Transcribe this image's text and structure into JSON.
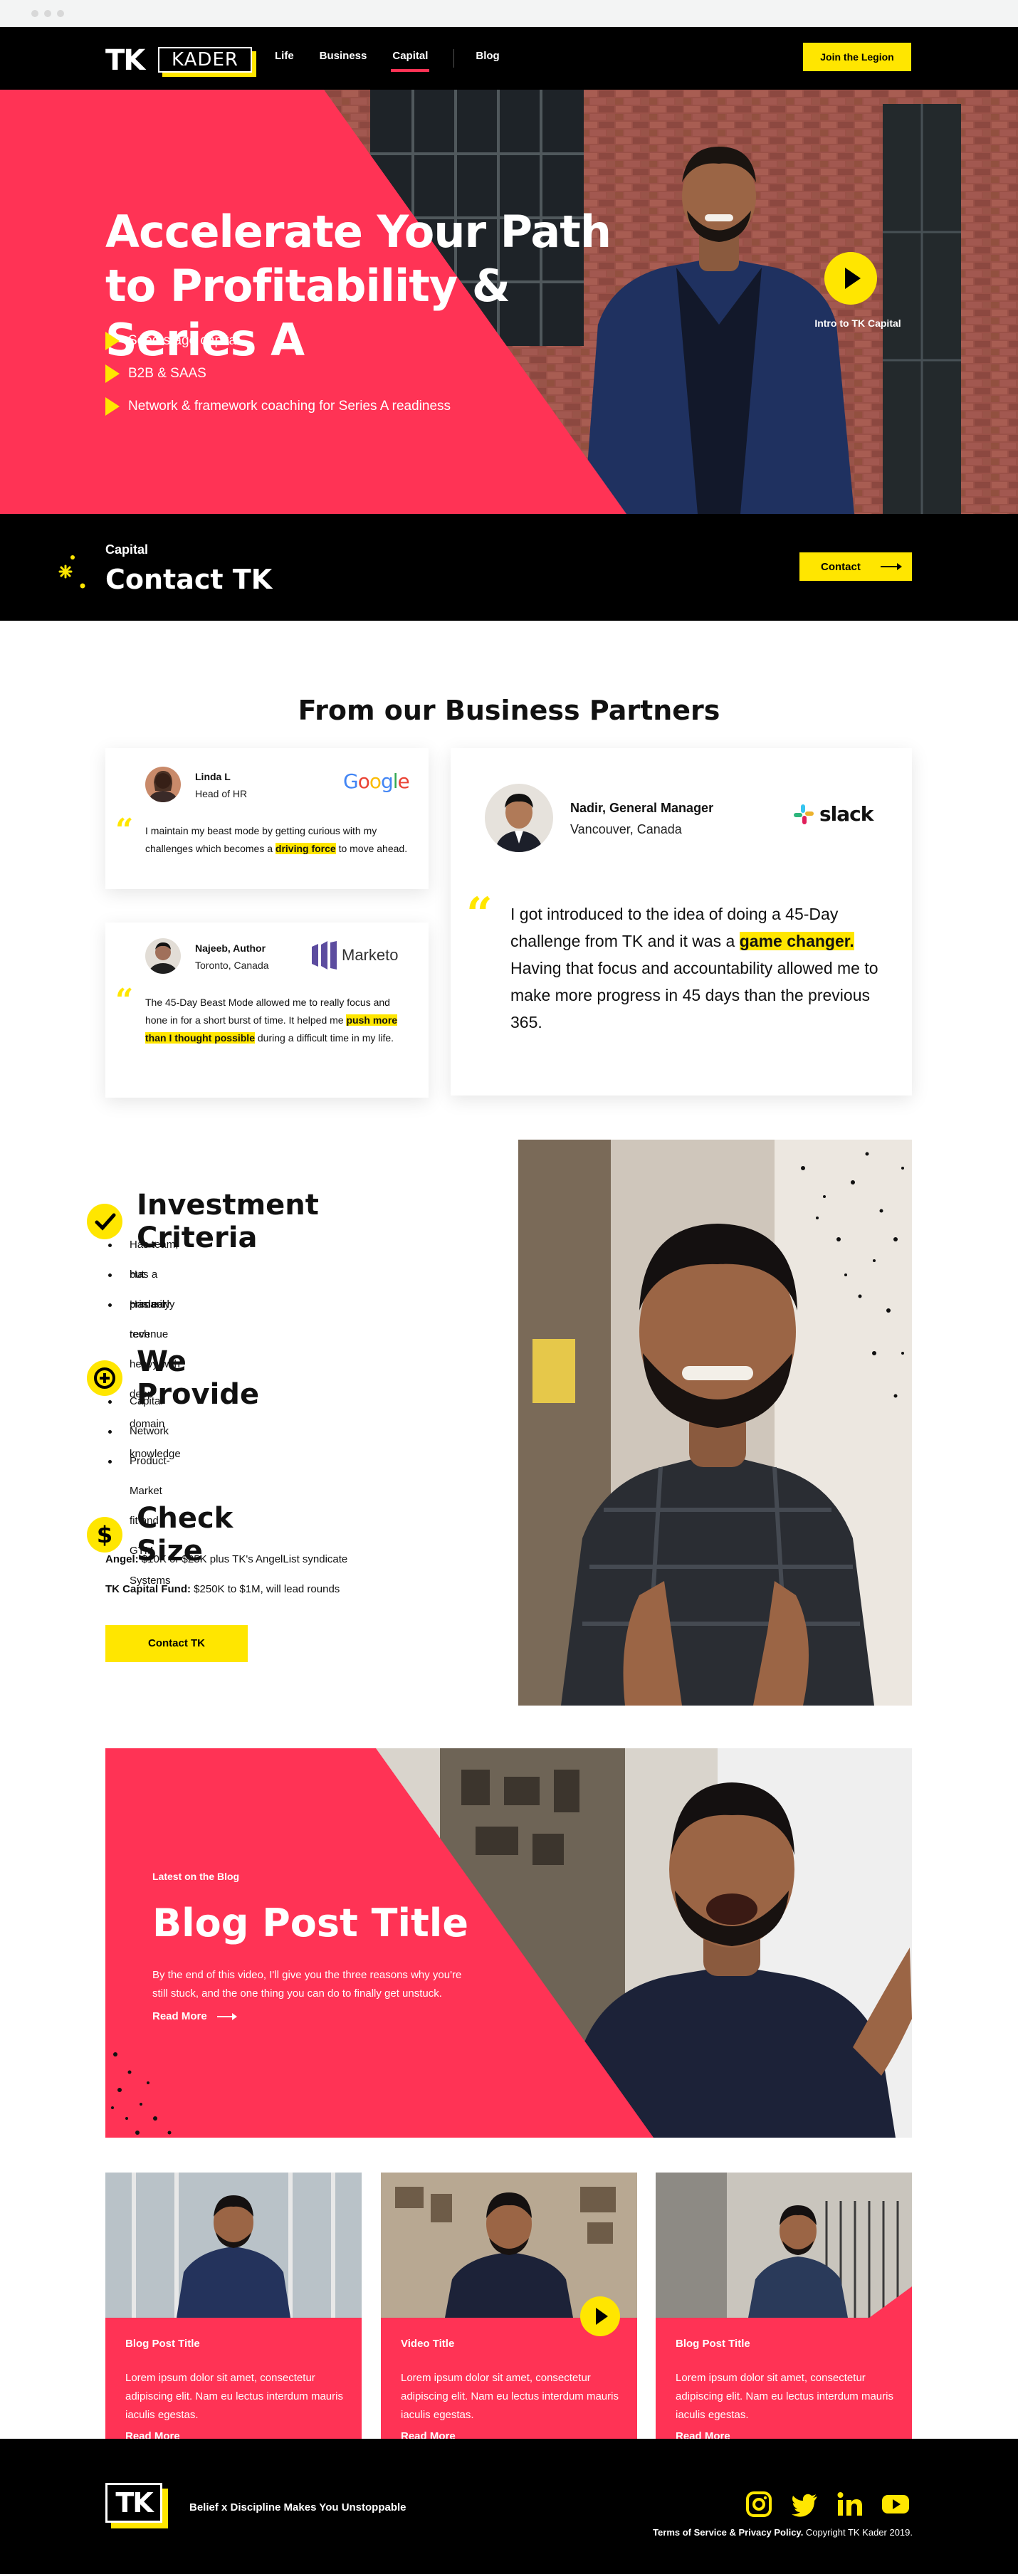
{
  "colors": {
    "accent_pink": "#ff3355",
    "accent_yellow": "#ffe600",
    "black": "#000000"
  },
  "nav": {
    "logo_tk": "TK",
    "logo_kader": "KADER",
    "links": [
      "Life",
      "Business",
      "Capital",
      "Blog"
    ],
    "active": "Capital",
    "join_label": "Join the Legion"
  },
  "hero": {
    "title": "Accelerate Your Path to Profitability & Series A",
    "bullets": [
      "Seed stage capital",
      "B2B & SAAS",
      "Network & framework coaching for Series A readiness"
    ],
    "video_caption": "Intro to TK Capital"
  },
  "contact_band": {
    "label": "Capital",
    "title": "Contact TK",
    "button": "Contact"
  },
  "partners": {
    "title": "From our Business Partners",
    "testimonials": [
      {
        "name": "Linda L",
        "role": "Head of HR",
        "company": "Google",
        "text_before": "I maintain my beast mode by getting curious with my challenges which becomes a ",
        "highlight": "driving force",
        "text_after": " to move ahead."
      },
      {
        "name": "Najeeb, Author",
        "role": "Toronto, Canada",
        "company": "Marketo",
        "text_before": "The 45-Day Beast Mode allowed me to really focus and hone in for a short burst of time. It helped me ",
        "highlight": "push more than I thought possible",
        "text_after": " during a difficult time in my life."
      },
      {
        "name": "Nadir, General Manager",
        "role": "Vancouver, Canada",
        "company": "slack",
        "text_before": "I got introduced to the idea of doing a 45-Day challenge from TK and it was a ",
        "highlight": "game changer.",
        "text_after": " Having that focus and accountability allowed me to make more progress in 45 days than the previous 365."
      }
    ]
  },
  "criteria": {
    "investment": {
      "title": "Investment Criteria",
      "items": [
        "Has team, but primarily tech heavy with deep domain knowledge",
        "Has a product",
        "Has early revenue"
      ]
    },
    "provide": {
      "title": "We Provide",
      "items": [
        "Capital",
        "Network",
        "Product-Market fit and GTM Systems"
      ]
    },
    "check": {
      "title": "Check Size",
      "angel_label": "Angel:",
      "angel_text": " $10K or $25K plus TK's AngelList syndicate",
      "fund_label": "TK Capital Fund:",
      "fund_text": " $250K to $1M, will lead rounds",
      "button": "Contact TK"
    }
  },
  "blog": {
    "feature": {
      "label": "Latest on the Blog",
      "title": "Blog Post Title",
      "desc": "By the end of this video, I'll give you the three reasons why you're still stuck, and the one thing you can do to finally get unstuck.",
      "more": "Read More"
    },
    "cards": [
      {
        "title": "Blog Post Title",
        "body": "Lorem ipsum dolor sit amet, consectetur adipiscing elit. Nam eu lectus interdum mauris iaculis egestas.",
        "more": "Read More"
      },
      {
        "title": "Video Title",
        "body": "Lorem ipsum dolor sit amet, consectetur adipiscing elit. Nam eu lectus interdum mauris iaculis egestas.",
        "more": "Read More"
      },
      {
        "title": "Blog Post Title",
        "body": "Lorem ipsum dolor sit amet, consectetur adipiscing elit. Nam eu lectus interdum mauris iaculis egestas.",
        "more": "Read More"
      }
    ]
  },
  "footer": {
    "logo": "TK",
    "tagline": "Belief x Discipline Makes You Unstoppable",
    "social_icons": [
      "instagram-icon",
      "twitter-icon",
      "linkedin-icon",
      "youtube-icon"
    ],
    "legal_links": "Terms of Service & Privacy Policy.",
    "copyright": " Copyright TK Kader 2019."
  }
}
